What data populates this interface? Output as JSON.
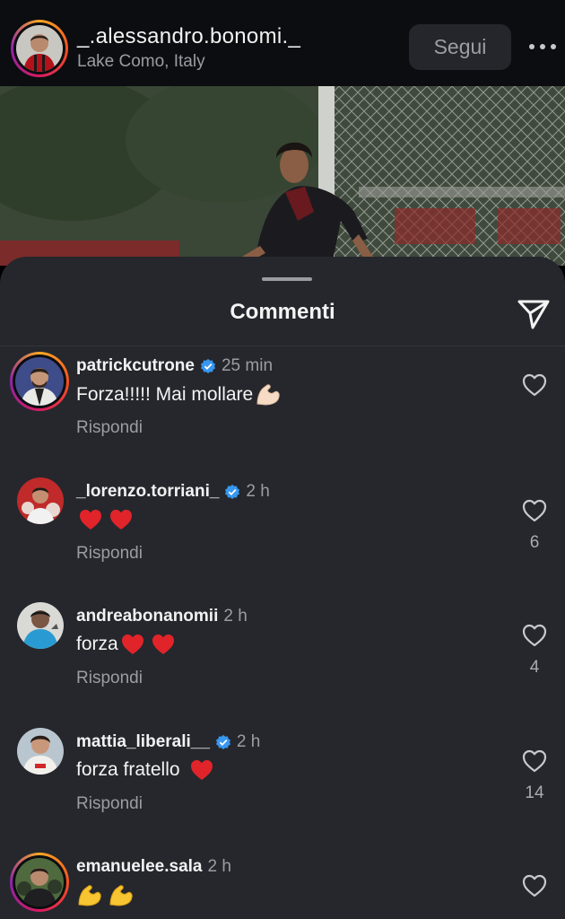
{
  "post": {
    "username": "_.alessandro.bonomi._",
    "location": "Lake Como, Italy",
    "follow_label": "Segui"
  },
  "sheet": {
    "title": "Commenti"
  },
  "colors": {
    "background": "#25272c",
    "verified": "#3897f0",
    "heart_emoji": "#e0242a",
    "muted_text": "#9b9da3"
  },
  "comments": [
    {
      "username": "patrickcutrone",
      "verified": true,
      "time": "25 min",
      "text": "Forza!!!!! Mai mollare",
      "emojis": [
        "flexed-biceps-light"
      ],
      "reply_label": "Rispondi",
      "likes": ""
    },
    {
      "username": "_lorenzo.torriani_",
      "verified": true,
      "time": "2 h",
      "text": "",
      "emojis": [
        "red-heart",
        "red-heart"
      ],
      "reply_label": "Rispondi",
      "likes": "6"
    },
    {
      "username": "andreabonanomii",
      "verified": false,
      "time": "2 h",
      "text": "forza",
      "emojis": [
        "red-heart",
        "red-heart"
      ],
      "reply_label": "Rispondi",
      "likes": "4"
    },
    {
      "username": "mattia_liberali__",
      "verified": true,
      "time": "2 h",
      "text": "forza fratello",
      "emojis": [
        "red-heart"
      ],
      "reply_label": "Rispondi",
      "likes": "14"
    },
    {
      "username": "emanuelee.sala",
      "verified": false,
      "time": "2 h",
      "text": "",
      "emojis": [
        "flexed-biceps",
        "flexed-biceps"
      ],
      "reply_label": "",
      "likes": ""
    }
  ]
}
